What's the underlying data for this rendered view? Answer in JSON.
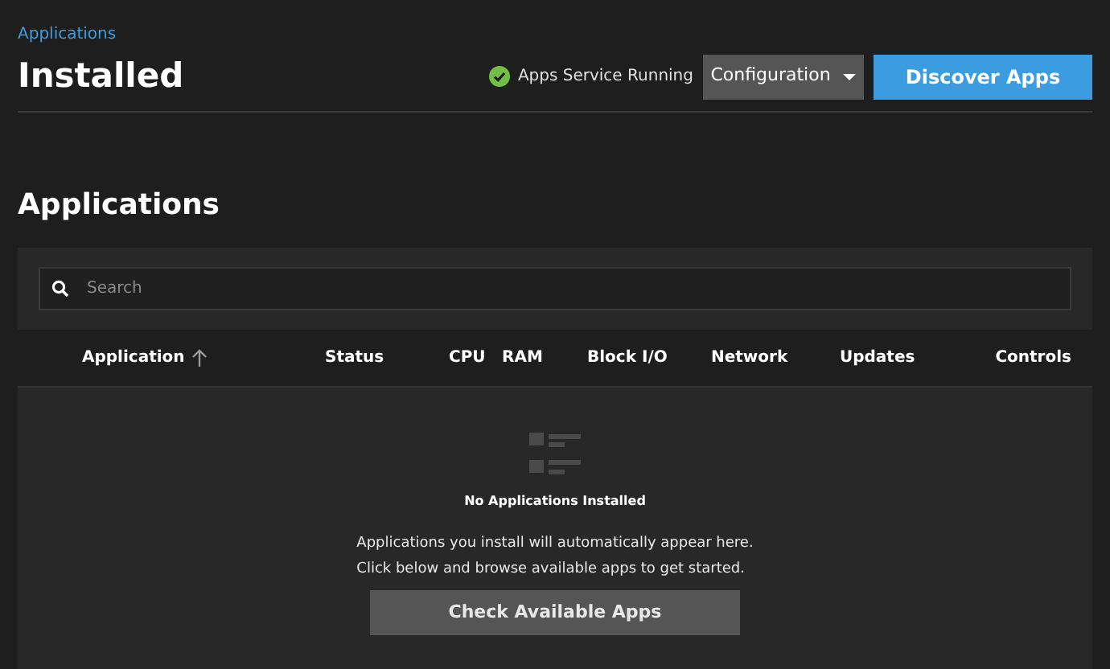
{
  "breadcrumb": "Applications",
  "title": "Installed",
  "service_status": {
    "label": "Apps Service Running",
    "running": true
  },
  "configuration_button": "Configuration",
  "discover_button": "Discover Apps",
  "section_title": "Applications",
  "search": {
    "placeholder": "Search"
  },
  "table": {
    "columns": [
      {
        "label": "Application",
        "sorted": true
      },
      {
        "label": "Status",
        "sorted": false
      },
      {
        "label": "CPU",
        "sorted": false
      },
      {
        "label": "RAM",
        "sorted": false
      },
      {
        "label": "Block I/O",
        "sorted": false
      },
      {
        "label": "Network",
        "sorted": false
      },
      {
        "label": "Updates",
        "sorted": false
      },
      {
        "label": "Controls",
        "sorted": false
      }
    ]
  },
  "empty_state": {
    "title": "No Applications Installed",
    "message": [
      "Applications you install will automatically appear here.",
      "Click below and browse available apps to get started."
    ],
    "button": "Check Available Apps"
  }
}
